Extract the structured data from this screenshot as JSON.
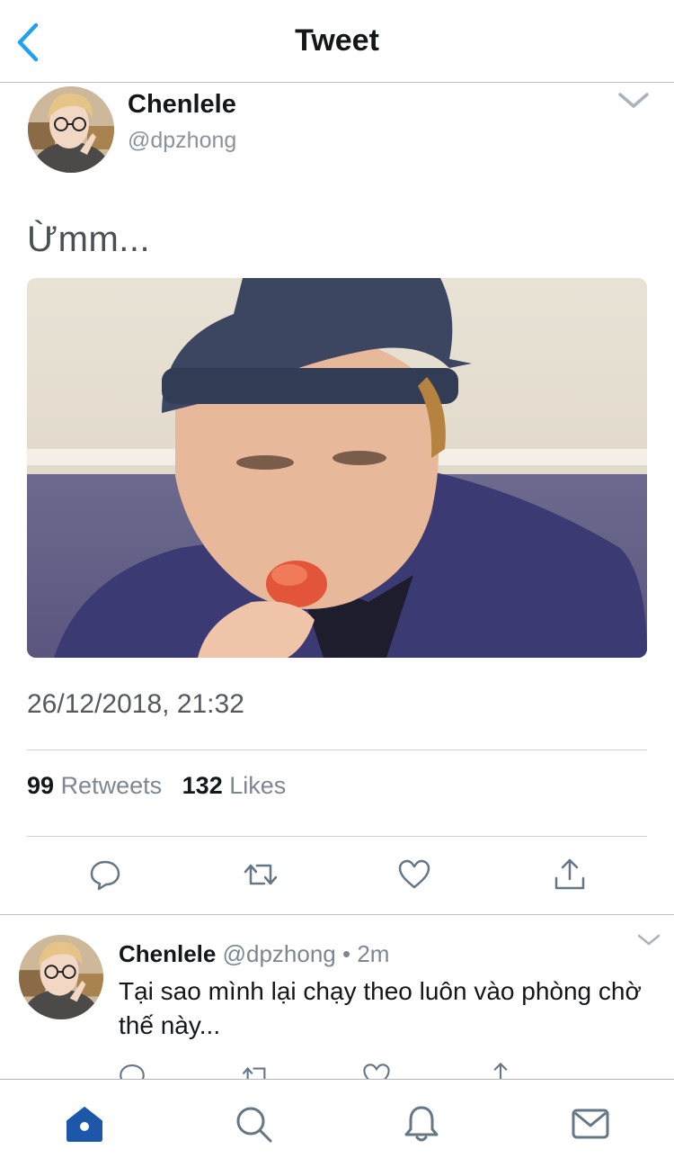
{
  "header": {
    "title": "Tweet",
    "back_icon": "chevron-left-icon"
  },
  "tweet": {
    "author_name": "Chenlele",
    "author_handle": "@dpzhong",
    "text": "Ừmm...",
    "timestamp": "26/12/2018, 21:32",
    "retweets_count": "99",
    "retweets_label": "Retweets",
    "likes_count": "132",
    "likes_label": "Likes",
    "actions": [
      "reply-icon",
      "retweet-icon",
      "like-icon",
      "share-icon"
    ]
  },
  "reply": {
    "author_name": "Chenlele",
    "meta": "@dpzhong • 2m",
    "text": "Tại sao mình lại chạy theo luôn vào phòng chờ thế này..."
  },
  "tabbar": {
    "items": [
      "home-icon",
      "search-icon",
      "notifications-icon",
      "messages-icon"
    ]
  },
  "colors": {
    "accent": "#1da1f2",
    "tab_active": "#1c57a9",
    "icon_gray": "#657786"
  }
}
